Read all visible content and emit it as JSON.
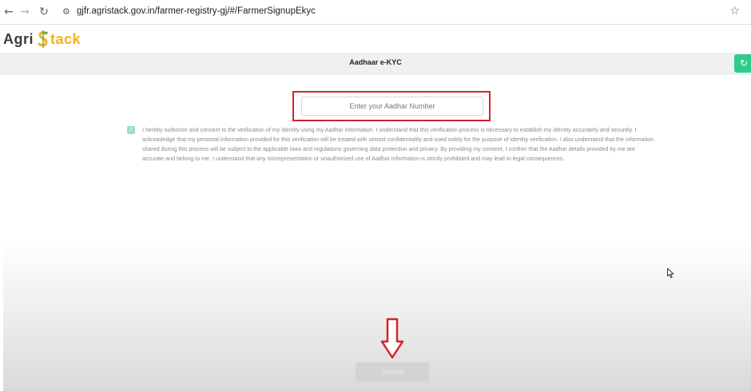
{
  "browser": {
    "back_icon": "←",
    "forward_icon": "→",
    "reload_icon": "↻",
    "site_info_icon": "⚙",
    "url": "gjfr.agristack.gov.in/farmer-registry-gj/#/FarmerSignupEkyc",
    "bookmark_icon": "☆"
  },
  "header": {
    "logo_part1": "Agri",
    "logo_part2": "tack"
  },
  "title_band": {
    "title": "Aadhaar e-KYC",
    "refresh_icon": "↻"
  },
  "form": {
    "aadhar_placeholder": "Enter your Aadhar Number",
    "aadhar_value": "",
    "consent_checked": true,
    "consent_check_glyph": "✓",
    "consent_text": "I hereby authorize and consent to the verification of my identity using my Aadhar information. I understand that this verification process is necessary to establish my identity accurately and securely. I acknowledge that my personal information provided for this verification will be treated with utmost confidentiality and used solely for the purpose of identity verification. I also understand that the information shared during this process will be subject to the applicable laws and regulations governing data protection and privacy. By providing my consent, I confirm that the Aadhar details provided by me are accurate and belong to me. I understand that any misrepresentation or unauthorized use of Aadhar information is strictly prohibited and may lead to legal consequences.",
    "submit_label": "Submit"
  },
  "colors": {
    "highlight_red": "#d0242b",
    "accent_green": "#2ecc8b",
    "logo_yellow": "#f2b21c"
  }
}
